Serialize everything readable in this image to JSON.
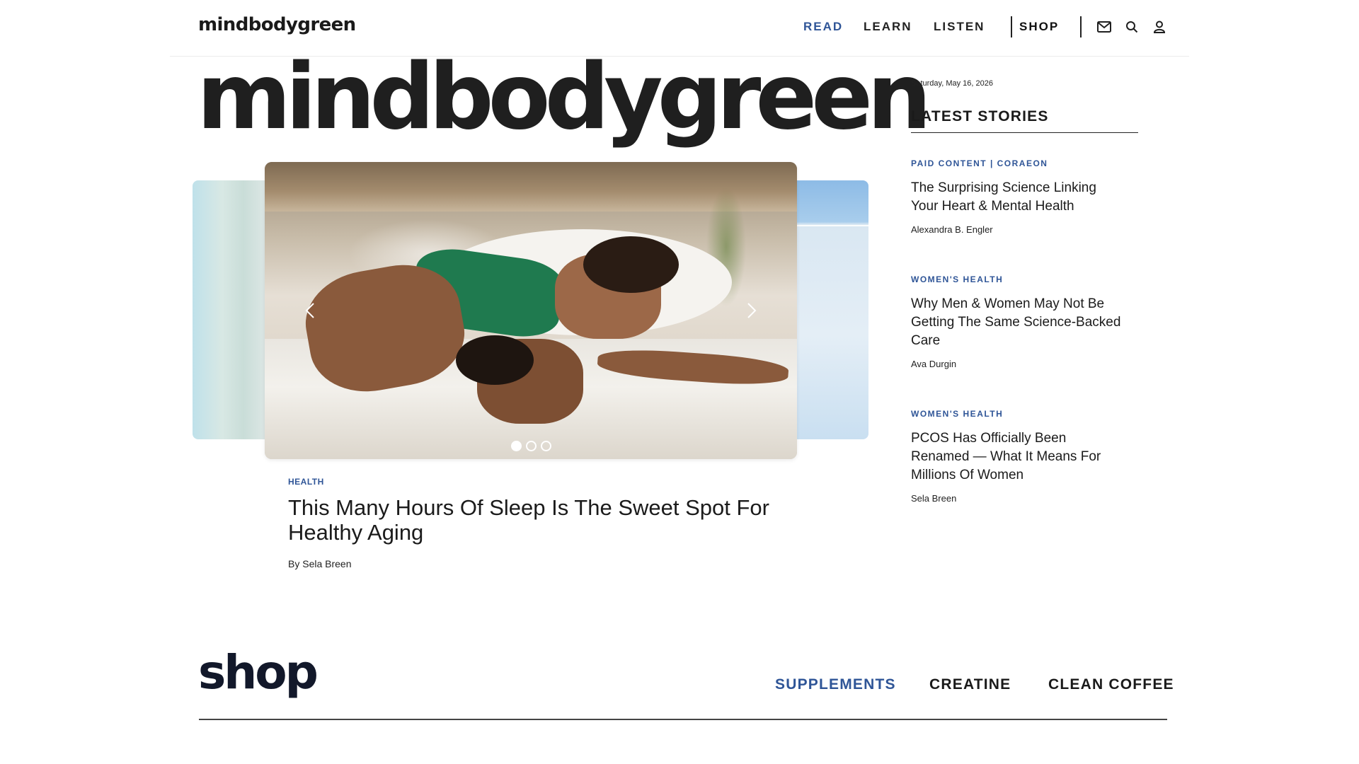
{
  "header": {
    "logo": "mindbodygreen",
    "nav": {
      "read": "READ",
      "learn": "LEARN",
      "listen": "LISTEN",
      "shop": "SHOP"
    },
    "icons": [
      "mail-icon",
      "search-icon",
      "user-icon"
    ]
  },
  "hero": {
    "wordmark": "mindbodygreen"
  },
  "carousel": {
    "slide_count": 3,
    "active_slide": 1,
    "image_description_icon": "photo"
  },
  "featured": {
    "category": "HEALTH",
    "title": "This Many Hours Of Sleep Is The Sweet Spot For Healthy Aging",
    "author": "By Sela Breen"
  },
  "sidebar": {
    "date": "Saturday, May 16, 2026",
    "heading": "LATEST STORIES",
    "stories": [
      {
        "category": "PAID CONTENT | CORAEON",
        "title": "The Surprising Science Linking Your Heart & Mental Health",
        "author": "Alexandra B. Engler"
      },
      {
        "category": "WOMEN'S HEALTH",
        "title": "Why Men & Women May Not Be Getting The Same Science-Backed Care",
        "author": "Ava Durgin"
      },
      {
        "category": "WOMEN'S HEALTH",
        "title": "PCOS Has Officially Been Renamed — What It Means For Millions Of Women",
        "author": "Sela Breen"
      }
    ]
  },
  "shop": {
    "title": "shop",
    "links": [
      "SUPPLEMENTS",
      "CREATINE",
      "CLEAN COFFEE"
    ]
  },
  "colors": {
    "accent": "#2f5597",
    "text": "#1b1b1b",
    "shop_title": "#12182a"
  }
}
